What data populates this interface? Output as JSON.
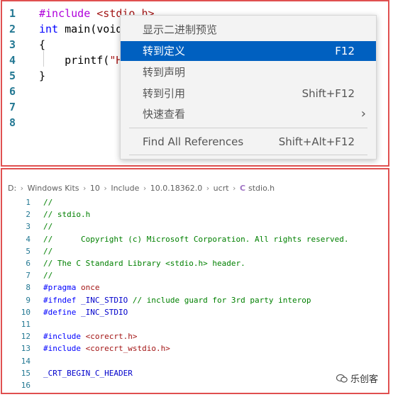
{
  "top_editor": {
    "lines": [
      {
        "n": "1",
        "segs": [
          [
            "pp",
            "#include "
          ],
          [
            "str",
            "<stdio.h>"
          ]
        ]
      },
      {
        "n": "2",
        "segs": [
          [
            "kw",
            "int"
          ],
          [
            "plain",
            " main(void)"
          ]
        ]
      },
      {
        "n": "3",
        "segs": [
          [
            "plain",
            "{"
          ]
        ]
      },
      {
        "n": "4",
        "segs": [
          [
            "plain",
            "    printf("
          ],
          [
            "str",
            "\"H"
          ]
        ]
      },
      {
        "n": "5",
        "segs": [
          [
            "plain",
            "}"
          ]
        ]
      },
      {
        "n": "6",
        "segs": []
      },
      {
        "n": "7",
        "segs": []
      },
      {
        "n": "8",
        "segs": []
      }
    ]
  },
  "context_menu": {
    "items": [
      {
        "label": "显示二进制预览",
        "shortcut": ""
      },
      {
        "label": "转到定义",
        "shortcut": "F12"
      },
      {
        "label": "转到声明",
        "shortcut": ""
      },
      {
        "label": "转到引用",
        "shortcut": "Shift+F12"
      },
      {
        "label": "快速查看",
        "shortcut": ""
      },
      {
        "label": "Find All References",
        "shortcut": "Shift+Alt+F12"
      }
    ],
    "active_index": 1
  },
  "breadcrumb": {
    "parts": [
      "D:",
      "Windows Kits",
      "10",
      "Include",
      "10.0.18362.0",
      "ucrt"
    ],
    "file_icon": "C",
    "file": "stdio.h"
  },
  "bottom_editor": {
    "lines": [
      {
        "n": "1",
        "segs": [
          [
            "cmt",
            "//"
          ]
        ]
      },
      {
        "n": "2",
        "segs": [
          [
            "cmt",
            "// stdio.h"
          ]
        ]
      },
      {
        "n": "3",
        "segs": [
          [
            "cmt",
            "//"
          ]
        ]
      },
      {
        "n": "4",
        "segs": [
          [
            "cmt",
            "//      Copyright (c) Microsoft Corporation. All rights reserved."
          ]
        ]
      },
      {
        "n": "5",
        "segs": [
          [
            "cmt",
            "//"
          ]
        ]
      },
      {
        "n": "6",
        "segs": [
          [
            "cmt",
            "// The C Standard Library <stdio.h> header."
          ]
        ]
      },
      {
        "n": "7",
        "segs": [
          [
            "cmt",
            "//"
          ]
        ]
      },
      {
        "n": "8",
        "segs": [
          [
            "pp",
            "#pragma "
          ],
          [
            "inc",
            "once"
          ]
        ]
      },
      {
        "n": "9",
        "segs": [
          [
            "pp",
            "#ifndef "
          ],
          [
            "macro",
            "_INC_STDIO "
          ],
          [
            "cmt",
            "// include guard for 3rd party interop"
          ]
        ]
      },
      {
        "n": "10",
        "segs": [
          [
            "pp",
            "#define "
          ],
          [
            "macro",
            "_INC_STDIO"
          ]
        ]
      },
      {
        "n": "11",
        "segs": []
      },
      {
        "n": "12",
        "segs": [
          [
            "pp",
            "#include "
          ],
          [
            "inc",
            "<corecrt.h>"
          ]
        ]
      },
      {
        "n": "13",
        "segs": [
          [
            "pp",
            "#include "
          ],
          [
            "inc",
            "<corecrt_wstdio.h>"
          ]
        ]
      },
      {
        "n": "14",
        "segs": []
      },
      {
        "n": "15",
        "segs": [
          [
            "macro",
            "_CRT_BEGIN_C_HEADER"
          ]
        ]
      },
      {
        "n": "16",
        "segs": []
      }
    ]
  },
  "watermark": {
    "text": "乐创客"
  },
  "colors": {
    "accent": "#0060c0",
    "border": "#e05050",
    "line_number": "#237893",
    "comment": "#008000"
  }
}
